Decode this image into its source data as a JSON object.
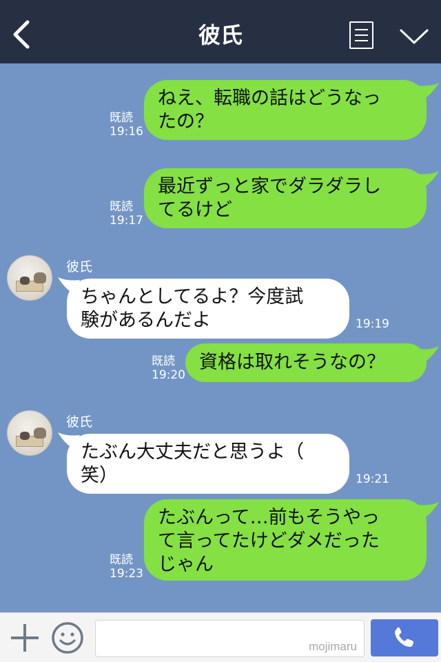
{
  "header": {
    "title": "彼氏",
    "back_icon": "chevron-left-icon",
    "note_icon": "note-icon",
    "menu_icon": "chevron-down-icon"
  },
  "colors": {
    "header_bg": "#273043",
    "chat_bg": "#7395c6",
    "my_bubble": "#84e043",
    "their_bubble": "#ffffff",
    "send_button": "#5479d9"
  },
  "messages": [
    {
      "from": "me",
      "text": "ねえ、転職の話はどうなっ\nたの？",
      "read_label": "既読",
      "time": "19:16"
    },
    {
      "from": "me",
      "text": "最近ずっと家でダラダラし\nてるけど",
      "read_label": "既読",
      "time": "19:17"
    },
    {
      "from": "them",
      "sender": "彼氏",
      "text": "ちゃんとしてるよ？今度試\n験があるんだよ",
      "time": "19:19"
    },
    {
      "from": "me",
      "text": "資格は取れそうなの？",
      "read_label": "既読",
      "time": "19:20"
    },
    {
      "from": "them",
      "sender": "彼氏",
      "text": "たぶん大丈夫だと思うよ（\n笑）",
      "time": "19:21"
    },
    {
      "from": "me",
      "text": "たぶんって…前もそうやっ\nて言ってたけどダメだった\nじゃん",
      "read_label": "既読",
      "time": "19:23"
    }
  ],
  "footer": {
    "plus_icon": "plus-icon",
    "emoji_icon": "emoji-icon",
    "input_value": "",
    "watermark": "mojimaru",
    "call_icon": "phone-icon"
  }
}
